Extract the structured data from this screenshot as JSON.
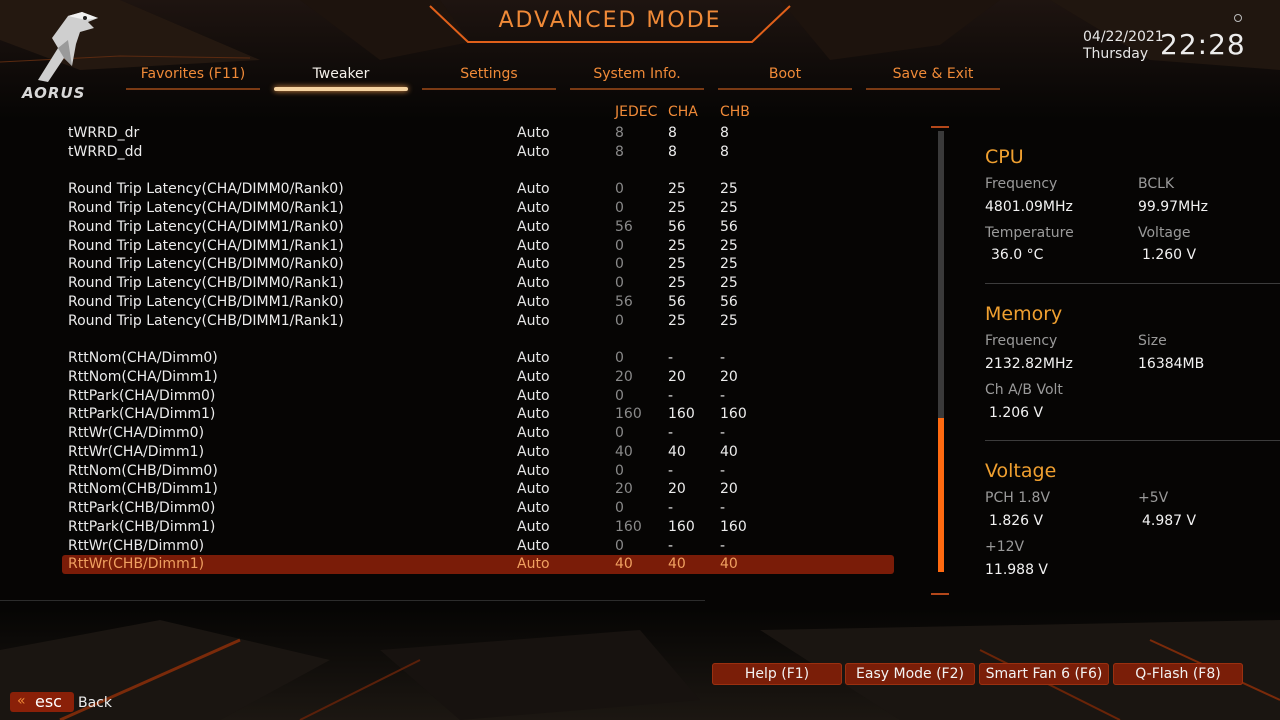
{
  "header": {
    "title": "ADVANCED MODE",
    "brand": "AORUS",
    "date": "04/22/2021",
    "day": "Thursday",
    "time": "22:28"
  },
  "tabs": [
    {
      "label": "Favorites (F11)",
      "active": false
    },
    {
      "label": "Tweaker",
      "active": true
    },
    {
      "label": "Settings",
      "active": false
    },
    {
      "label": "System Info.",
      "active": false
    },
    {
      "label": "Boot",
      "active": false
    },
    {
      "label": "Save & Exit",
      "active": false
    }
  ],
  "table": {
    "columns": [
      "JEDEC",
      "CHA",
      "CHB"
    ],
    "rows": [
      {
        "name": "tWRRD_dr",
        "setting": "Auto",
        "jedec": "8",
        "cha": "8",
        "chb": "8"
      },
      {
        "name": "tWRRD_dd",
        "setting": "Auto",
        "jedec": "8",
        "cha": "8",
        "chb": "8"
      },
      {
        "name": "Round Trip Latency(CHA/DIMM0/Rank0)",
        "setting": "Auto",
        "jedec": "0",
        "cha": "25",
        "chb": "25"
      },
      {
        "name": "Round Trip Latency(CHA/DIMM0/Rank1)",
        "setting": "Auto",
        "jedec": "0",
        "cha": "25",
        "chb": "25"
      },
      {
        "name": "Round Trip Latency(CHA/DIMM1/Rank0)",
        "setting": "Auto",
        "jedec": "56",
        "cha": "56",
        "chb": "56"
      },
      {
        "name": "Round Trip Latency(CHA/DIMM1/Rank1)",
        "setting": "Auto",
        "jedec": "0",
        "cha": "25",
        "chb": "25"
      },
      {
        "name": "Round Trip Latency(CHB/DIMM0/Rank0)",
        "setting": "Auto",
        "jedec": "0",
        "cha": "25",
        "chb": "25"
      },
      {
        "name": "Round Trip Latency(CHB/DIMM0/Rank1)",
        "setting": "Auto",
        "jedec": "0",
        "cha": "25",
        "chb": "25"
      },
      {
        "name": "Round Trip Latency(CHB/DIMM1/Rank0)",
        "setting": "Auto",
        "jedec": "56",
        "cha": "56",
        "chb": "56"
      },
      {
        "name": "Round Trip Latency(CHB/DIMM1/Rank1)",
        "setting": "Auto",
        "jedec": "0",
        "cha": "25",
        "chb": "25"
      },
      {
        "name": "RttNom(CHA/Dimm0)",
        "setting": "Auto",
        "jedec": "0",
        "cha": "-",
        "chb": "-"
      },
      {
        "name": "RttNom(CHA/Dimm1)",
        "setting": "Auto",
        "jedec": "20",
        "cha": "20",
        "chb": "20"
      },
      {
        "name": "RttPark(CHA/Dimm0)",
        "setting": "Auto",
        "jedec": "0",
        "cha": "-",
        "chb": "-"
      },
      {
        "name": "RttPark(CHA/Dimm1)",
        "setting": "Auto",
        "jedec": "160",
        "cha": "160",
        "chb": "160"
      },
      {
        "name": "RttWr(CHA/Dimm0)",
        "setting": "Auto",
        "jedec": "0",
        "cha": "-",
        "chb": "-"
      },
      {
        "name": "RttWr(CHA/Dimm1)",
        "setting": "Auto",
        "jedec": "40",
        "cha": "40",
        "chb": "40"
      },
      {
        "name": "RttNom(CHB/Dimm0)",
        "setting": "Auto",
        "jedec": "0",
        "cha": "-",
        "chb": "-"
      },
      {
        "name": "RttNom(CHB/Dimm1)",
        "setting": "Auto",
        "jedec": "20",
        "cha": "20",
        "chb": "20"
      },
      {
        "name": "RttPark(CHB/Dimm0)",
        "setting": "Auto",
        "jedec": "0",
        "cha": "-",
        "chb": "-"
      },
      {
        "name": "RttPark(CHB/Dimm1)",
        "setting": "Auto",
        "jedec": "160",
        "cha": "160",
        "chb": "160"
      },
      {
        "name": "RttWr(CHB/Dimm0)",
        "setting": "Auto",
        "jedec": "0",
        "cha": "-",
        "chb": "-"
      },
      {
        "name": "RttWr(CHB/Dimm1)",
        "setting": "Auto",
        "jedec": "40",
        "cha": "40",
        "chb": "40",
        "selected": true
      }
    ]
  },
  "side": {
    "cpu": {
      "title": "CPU",
      "frequency_label": "Frequency",
      "frequency": "4801.09MHz",
      "bclk_label": "BCLK",
      "bclk": "99.97MHz",
      "temperature_label": "Temperature",
      "temperature": "36.0 °C",
      "voltage_label": "Voltage",
      "voltage": "1.260 V"
    },
    "memory": {
      "title": "Memory",
      "frequency_label": "Frequency",
      "frequency": "2132.82MHz",
      "size_label": "Size",
      "size": "16384MB",
      "volt_label": "Ch A/B Volt",
      "volt": "1.206 V"
    },
    "voltage": {
      "title": "Voltage",
      "pch_label": "PCH 1.8V",
      "pch": "1.826 V",
      "v5_label": "+5V",
      "v5": "4.987 V",
      "v12_label": "+12V",
      "v12": "11.988 V"
    }
  },
  "footer": {
    "buttons": [
      "Help (F1)",
      "Easy Mode (F2)",
      "Smart Fan 6 (F6)",
      "Q-Flash (F8)"
    ],
    "esc_arrows": "«",
    "esc_label": "esc",
    "back_label": "Back"
  },
  "colors": {
    "accent": "#f08a38",
    "section_title": "#f0a030",
    "selected_row": "#7a1c08",
    "scroll_thumb": "#ff6a10"
  },
  "scrollbar": {
    "thumb_start_fraction": 0.65,
    "thumb_size_fraction": 0.35
  }
}
